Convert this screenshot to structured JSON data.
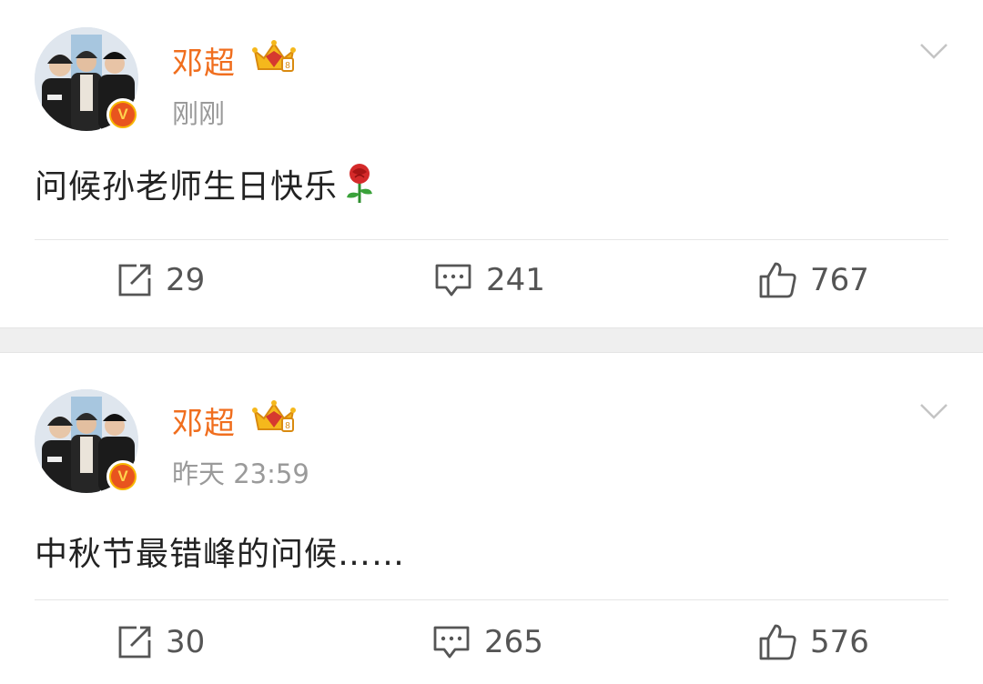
{
  "posts": [
    {
      "author": "邓超",
      "time": "刚刚",
      "content": "问候孙老师生日快乐",
      "content_emoji": "rose",
      "reposts": "29",
      "comments": "241",
      "likes": "767"
    },
    {
      "author": "邓超",
      "time": "昨天 23:59",
      "content": "中秋节最错峰的问候……",
      "reposts": "30",
      "comments": "265",
      "likes": "576"
    }
  ],
  "colors": {
    "author_name": "#f06e1e",
    "badge_outer": "#f7b500",
    "badge_inner": "#e8541e",
    "divider_band": "#efefef"
  },
  "badge_letter": "V"
}
